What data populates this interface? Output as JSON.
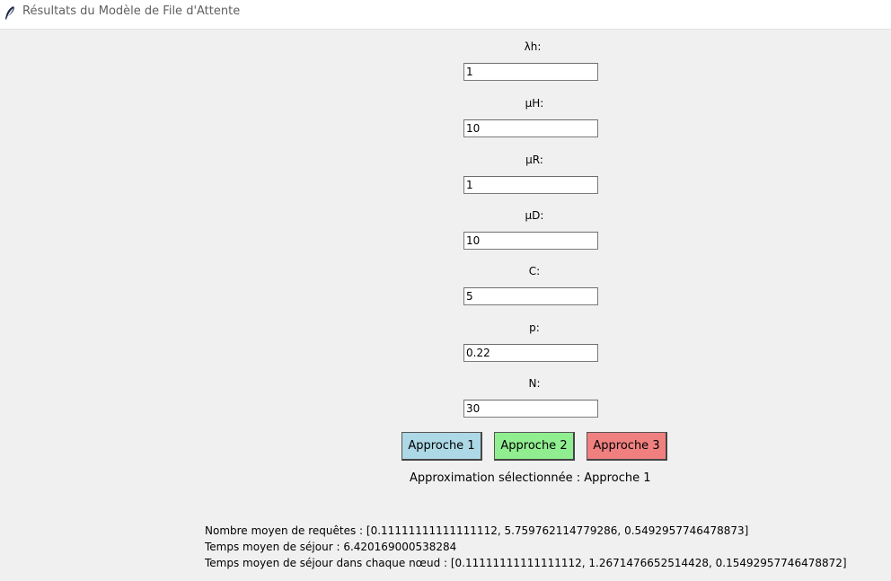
{
  "window": {
    "title": "Résultats du Modèle de File d'Attente",
    "icon": "feather-icon"
  },
  "fields": [
    {
      "label": "λh:",
      "value": "1"
    },
    {
      "label": "μH:",
      "value": "10"
    },
    {
      "label": "μR:",
      "value": "1"
    },
    {
      "label": "μD:",
      "value": "10"
    },
    {
      "label": "C:",
      "value": "5"
    },
    {
      "label": "p:",
      "value": "0.22"
    },
    {
      "label": "N:",
      "value": "30"
    }
  ],
  "buttons": [
    {
      "label": "Approche 1",
      "color": "#add8e6"
    },
    {
      "label": "Approche 2",
      "color": "#90ee90"
    },
    {
      "label": "Approche 3",
      "color": "#f08080"
    }
  ],
  "status": "Approximation sélectionnée : Approche 1",
  "results": {
    "line1": "Nombre moyen de requêtes : [0.11111111111111112, 5.759762114779286, 0.5492957746478873]",
    "line2": "Temps moyen de séjour : 6.420169000538284",
    "line3": "Temps moyen de séjour dans chaque nœud : [0.11111111111111112, 1.2671476652514428, 0.15492957746478872]"
  }
}
